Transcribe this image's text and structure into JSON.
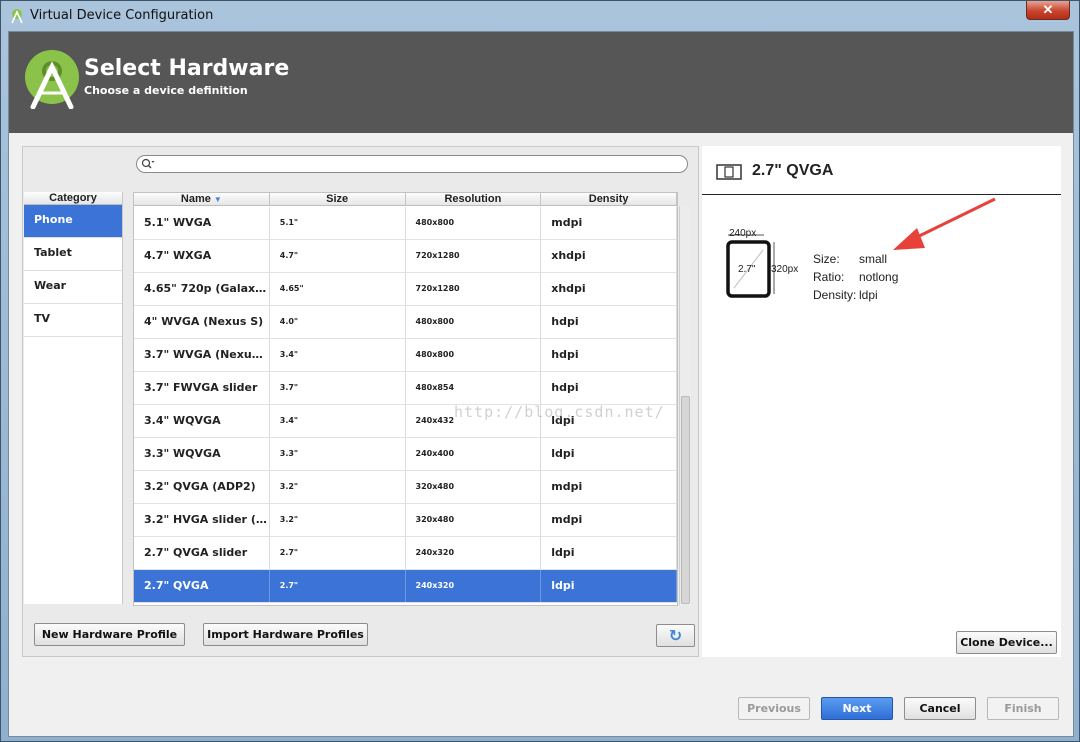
{
  "window": {
    "title": "Virtual Device Configuration",
    "close_glyph": "✕"
  },
  "header": {
    "title": "Select Hardware",
    "subtitle": "Choose a device definition"
  },
  "search": {
    "placeholder": ""
  },
  "category": {
    "header": "Category",
    "items": [
      {
        "label": "Phone",
        "selected": true
      },
      {
        "label": "Tablet",
        "selected": false
      },
      {
        "label": "Wear",
        "selected": false
      },
      {
        "label": "TV",
        "selected": false
      }
    ]
  },
  "table": {
    "columns": [
      "Name",
      "Size",
      "Resolution",
      "Density"
    ],
    "sort_indicator": "▼",
    "rows": [
      {
        "name": "5.1\" WVGA",
        "size": "5.1\"",
        "resolution": "480x800",
        "density": "mdpi"
      },
      {
        "name": "4.7\" WXGA",
        "size": "4.7\"",
        "resolution": "720x1280",
        "density": "xhdpi"
      },
      {
        "name": "4.65\" 720p (Galaxy ...",
        "size": "4.65\"",
        "resolution": "720x1280",
        "density": "xhdpi"
      },
      {
        "name": "4\" WVGA (Nexus S)",
        "size": "4.0\"",
        "resolution": "480x800",
        "density": "hdpi"
      },
      {
        "name": "3.7\" WVGA (Nexus ...",
        "size": "3.4\"",
        "resolution": "480x800",
        "density": "hdpi"
      },
      {
        "name": "3.7\" FWVGA slider",
        "size": "3.7\"",
        "resolution": "480x854",
        "density": "hdpi"
      },
      {
        "name": "3.4\" WQVGA",
        "size": "3.4\"",
        "resolution": "240x432",
        "density": "ldpi"
      },
      {
        "name": "3.3\" WQVGA",
        "size": "3.3\"",
        "resolution": "240x400",
        "density": "ldpi"
      },
      {
        "name": "3.2\" QVGA (ADP2)",
        "size": "3.2\"",
        "resolution": "320x480",
        "density": "mdpi"
      },
      {
        "name": "3.2\" HVGA slider (A...",
        "size": "3.2\"",
        "resolution": "320x480",
        "density": "mdpi"
      },
      {
        "name": "2.7\" QVGA slider",
        "size": "2.7\"",
        "resolution": "240x320",
        "density": "ldpi"
      },
      {
        "name": "2.7\" QVGA",
        "size": "2.7\"",
        "resolution": "240x320",
        "density": "ldpi",
        "selected": true
      }
    ]
  },
  "left_buttons": {
    "new_profile": "New Hardware Profile",
    "import_profiles": "Import Hardware Profiles",
    "refresh_glyph": "↻"
  },
  "details": {
    "title": "2.7\" QVGA",
    "preview": {
      "width_label": "240px",
      "height_label": "320px",
      "diagonal_label": "2.7\""
    },
    "size_label": "Size:",
    "size_value": "small",
    "ratio_label": "Ratio:",
    "ratio_value": "notlong",
    "density_label": "Density:",
    "density_value": "ldpi",
    "clone_button": "Clone Device..."
  },
  "watermark": "http://blog.csdn.net/",
  "footer": {
    "previous": "Previous",
    "next": "Next",
    "cancel": "Cancel",
    "finish": "Finish"
  },
  "colors": {
    "header_bg": "#565656",
    "selection": "#3b74d6",
    "arrow": "#e8413a",
    "logo_green": "#8bc34a"
  }
}
